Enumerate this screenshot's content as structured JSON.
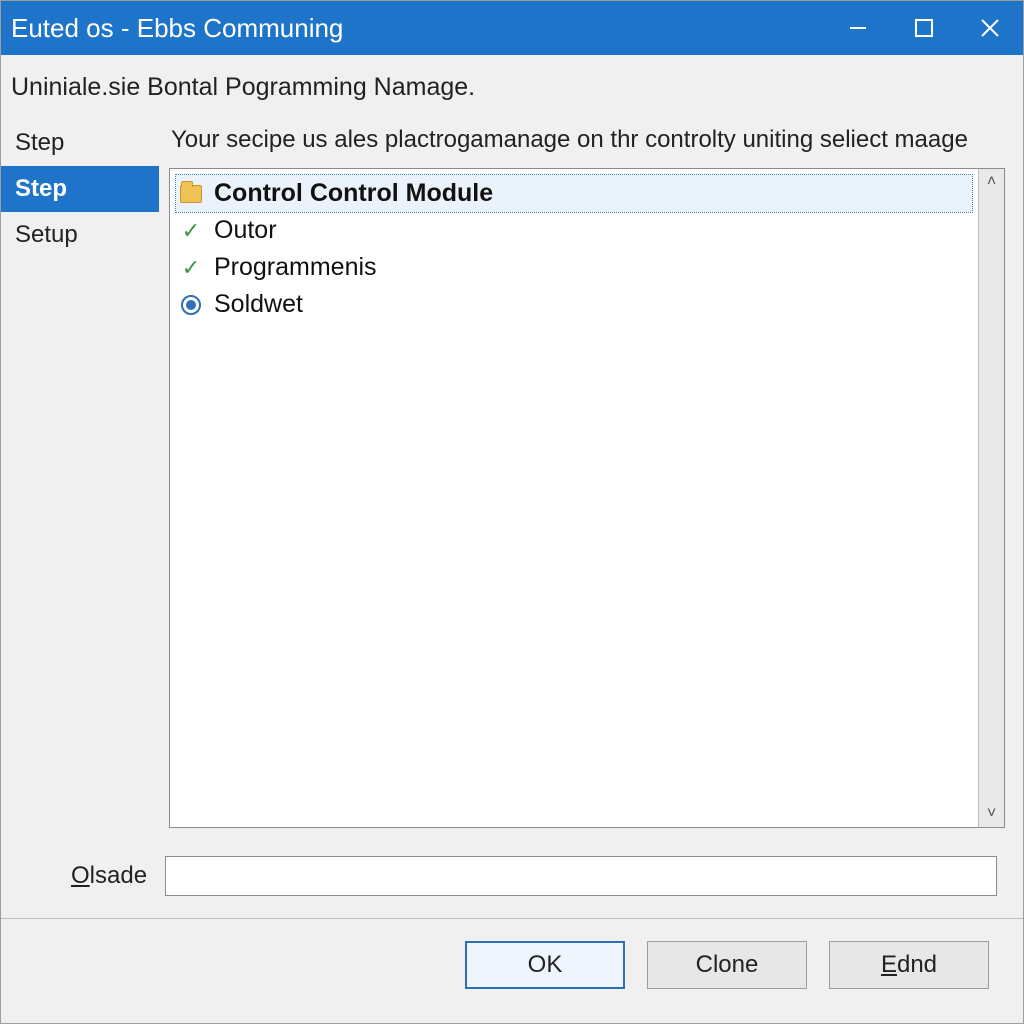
{
  "window": {
    "title": "Euted os - Ebbs Communing"
  },
  "header": {
    "text": "Uniniale.sie Bontal Pogramming Namage."
  },
  "sidebar": {
    "items": [
      {
        "label": "Step",
        "selected": false
      },
      {
        "label": "Step",
        "selected": true
      },
      {
        "label": "Setup",
        "selected": false
      }
    ]
  },
  "content": {
    "description": "Your secipe us ales plactrogamanage on thr controlty uniting seliect maage",
    "list": [
      {
        "label": "Control Control Module",
        "icon": "folder",
        "selected": true
      },
      {
        "label": "Outor",
        "icon": "check",
        "selected": false
      },
      {
        "label": "Programmenis",
        "icon": "check",
        "selected": false
      },
      {
        "label": "Soldwet",
        "icon": "radio",
        "selected": false
      }
    ]
  },
  "bottom": {
    "field_label_pre": "O",
    "field_label_rest": "lsade",
    "value": ""
  },
  "buttons": {
    "ok": "OK",
    "clone": "Clone",
    "ednd_pre": "E",
    "ednd_rest": "dnd"
  }
}
